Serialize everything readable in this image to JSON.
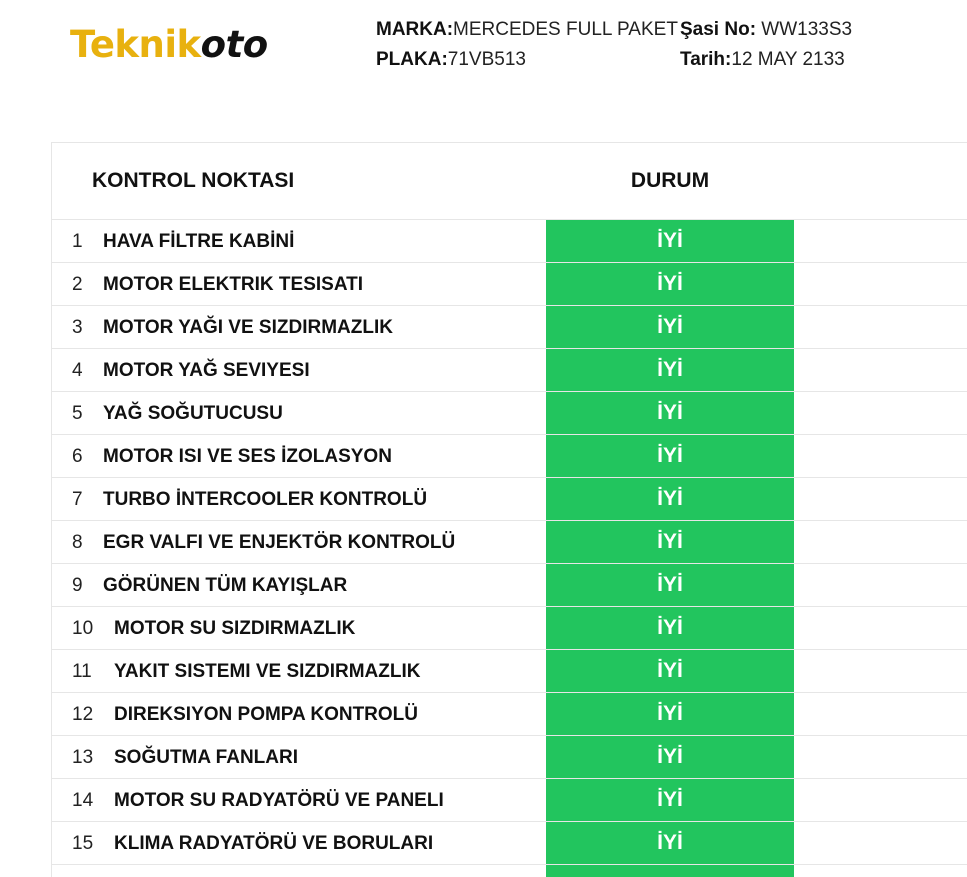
{
  "brand": {
    "part1": "Teknik",
    "part2": "oto"
  },
  "header": {
    "marka_label": "MARKA:",
    "marka_value": "MERCEDES FULL PAKET",
    "plaka_label": "PLAKA:",
    "plaka_value": "71VB513",
    "sasi_label": "Şasi No:",
    "sasi_value": " WW133S3",
    "tarih_label": "Tarih:",
    "tarih_value": "12 MAY 2133"
  },
  "table": {
    "col_kontrol": "KONTROL NOKTASI",
    "col_durum": "DURUM",
    "rows": [
      {
        "no": "1",
        "name": "HAVA FİLTRE KABİNİ",
        "status": "İYİ"
      },
      {
        "no": "2",
        "name": "MOTOR ELEKTRIK TESISATI",
        "status": "İYİ"
      },
      {
        "no": "3",
        "name": "MOTOR YAĞI VE SIZDIRMAZLIK",
        "status": "İYİ"
      },
      {
        "no": "4",
        "name": "MOTOR YAĞ SEVIYESI",
        "status": "İYİ"
      },
      {
        "no": "5",
        "name": "YAĞ SOĞUTUCUSU",
        "status": "İYİ"
      },
      {
        "no": "6",
        "name": "MOTOR ISI VE SES İZOLASYON",
        "status": "İYİ"
      },
      {
        "no": "7",
        "name": "TURBO İNTERCOOLER KONTROLÜ",
        "status": "İYİ"
      },
      {
        "no": "8",
        "name": "EGR VALFI VE ENJEKTÖR KONTROLÜ",
        "status": "İYİ"
      },
      {
        "no": "9",
        "name": "GÖRÜNEN TÜM KAYIŞLAR",
        "status": "İYİ"
      },
      {
        "no": "10",
        "name": "MOTOR SU SIZDIRMAZLIK",
        "status": "İYİ"
      },
      {
        "no": "11",
        "name": "YAKIT SISTEMI VE SIZDIRMAZLIK",
        "status": "İYİ"
      },
      {
        "no": "12",
        "name": "DIREKSIYON POMPA KONTROLÜ",
        "status": "İYİ"
      },
      {
        "no": "13",
        "name": "SOĞUTMA FANLARI",
        "status": "İYİ"
      },
      {
        "no": "14",
        "name": "MOTOR SU RADYATÖRÜ VE PANELI",
        "status": "İYİ"
      },
      {
        "no": "15",
        "name": "KLIMA RADYATÖRÜ VE BORULARI",
        "status": "İYİ"
      }
    ]
  },
  "colors": {
    "brand_yellow": "#e8b10f",
    "status_green": "#22c55e"
  }
}
